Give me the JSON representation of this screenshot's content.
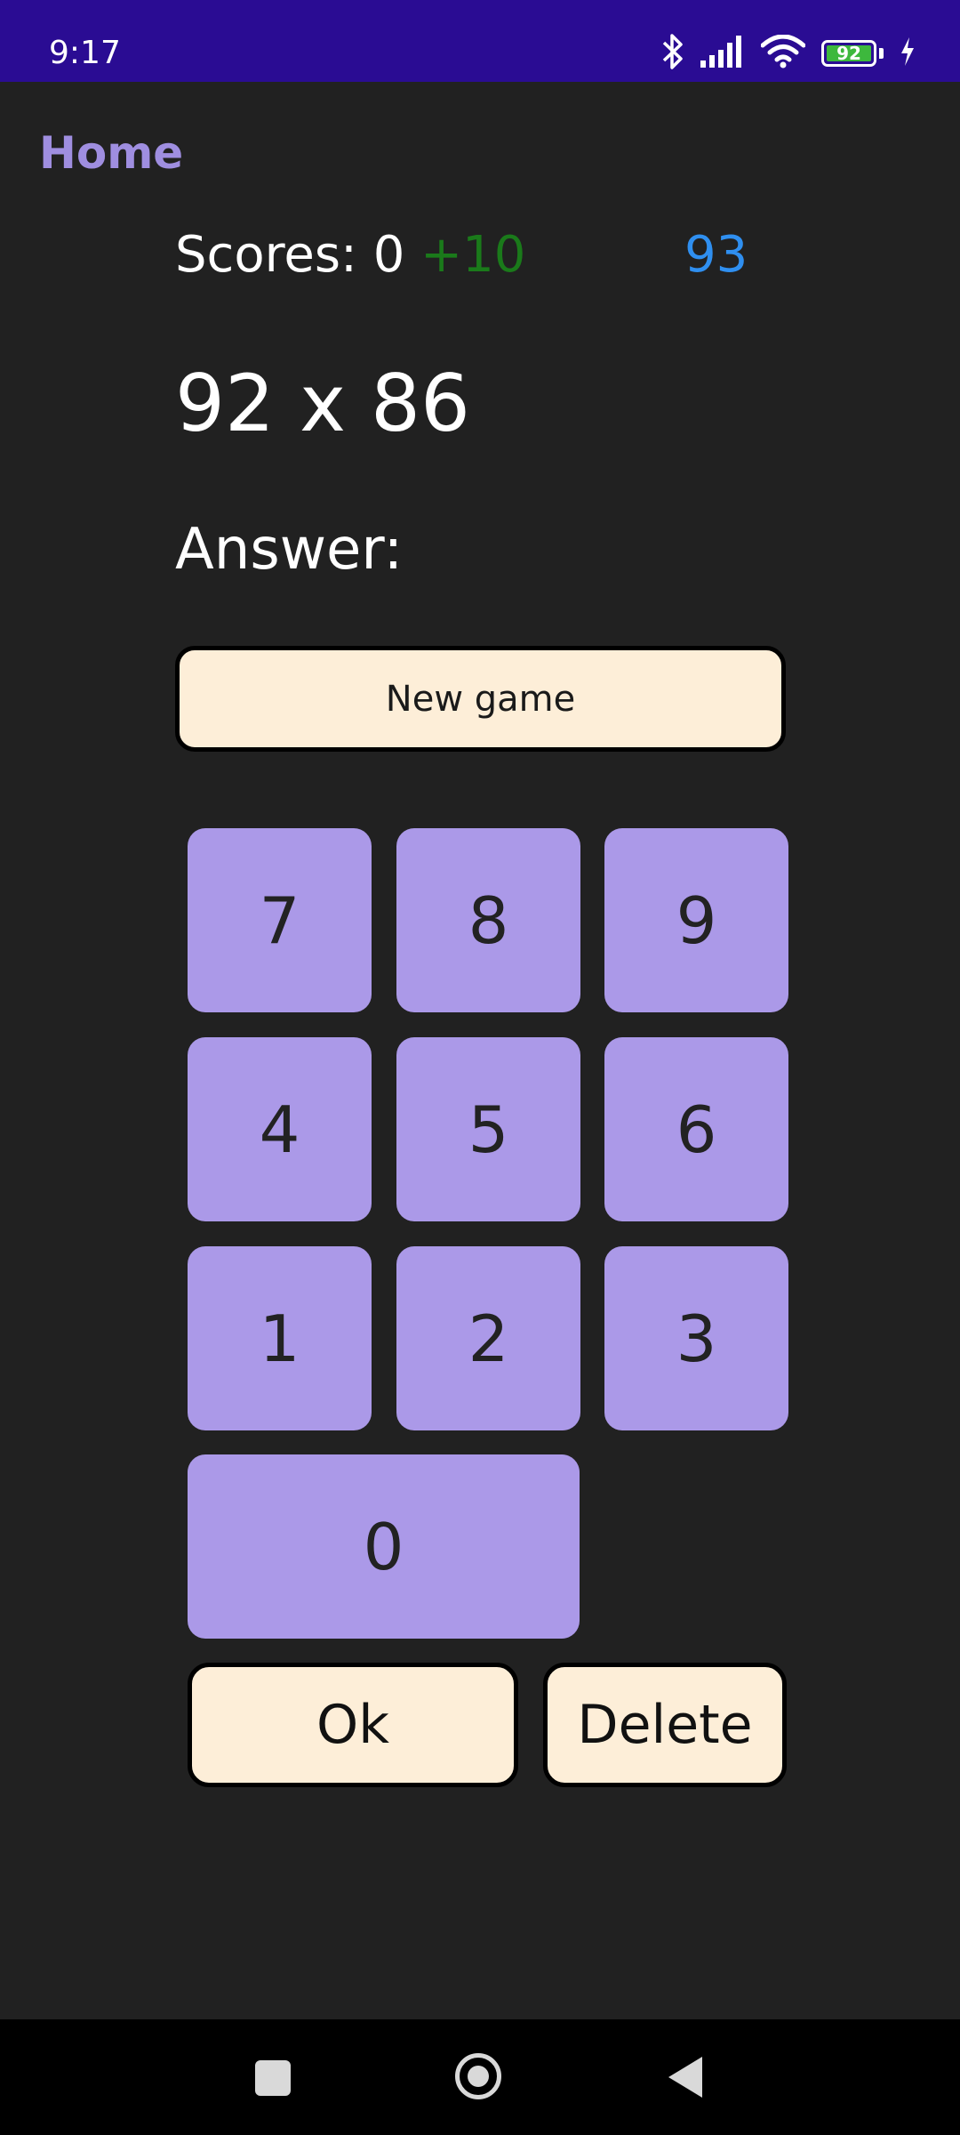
{
  "status_bar": {
    "time": "9:17",
    "battery_level": "92",
    "icons": [
      "bluetooth-icon",
      "signal-icon",
      "wifi-icon",
      "battery-icon",
      "charging-icon"
    ]
  },
  "header": {
    "title": "Home"
  },
  "game": {
    "scores_label": "Scores: 0",
    "scores_bonus": "+10",
    "timer": "93",
    "question": "92 x 86",
    "answer_label": "Answer:",
    "new_game_label": "New game"
  },
  "keypad": {
    "k7": "7",
    "k8": "8",
    "k9": "9",
    "k4": "4",
    "k5": "5",
    "k6": "6",
    "k1": "1",
    "k2": "2",
    "k3": "3",
    "k0": "0"
  },
  "actions": {
    "ok_label": "Ok",
    "delete_label": "Delete"
  },
  "colors": {
    "status_bar": "#2a0c93",
    "background": "#212121",
    "accent": "#9f8ee0",
    "key": "#ab99e8",
    "button": "#fdeed8",
    "bonus": "#1a7a1a",
    "timer": "#2f8ff0"
  }
}
